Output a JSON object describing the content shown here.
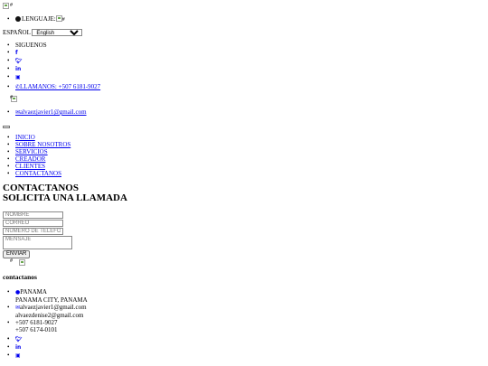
{
  "top": {
    "language_label": "LENGUAJE:",
    "language_current": "ESPAÑOL",
    "language_select_value": "English",
    "language_options": [
      "English"
    ]
  },
  "social": {
    "label": "SIGUENOS",
    "icons": [
      "facebook-icon",
      "twitter-icon",
      "linkedin-icon",
      "instagram-icon"
    ]
  },
  "contact_bar": {
    "phone_link": "LLAMANOS: +507 6181-9027",
    "email_link": "alvaezjavier1@gmail.com"
  },
  "nav": {
    "items": [
      "INICIO",
      "SOBRE NOSOTROS",
      "SERVICIOS",
      "CREADOR",
      "CLIENTES",
      "CONTACTANOS"
    ]
  },
  "main": {
    "heading1": "CONTACTANOS",
    "heading2": "SOLICITA UNA LLAMADA"
  },
  "form": {
    "name_placeholder": "NOMBRE",
    "email_placeholder": "CORREO",
    "phone_placeholder": "NUMERO DE TELEFONO",
    "message_placeholder": "MENSAJE",
    "submit_label": "ENVIAR"
  },
  "footer": {
    "title": "contactanos",
    "location": "PANAMA",
    "location_city": "PANAMA CITY, PANAMA",
    "email1": "alvaezjavier1@gmail.com",
    "email2": "alvaezdenise2@gmail.com",
    "phone1": "+507 6181-9027",
    "phone2": "+507 6174-0101"
  }
}
